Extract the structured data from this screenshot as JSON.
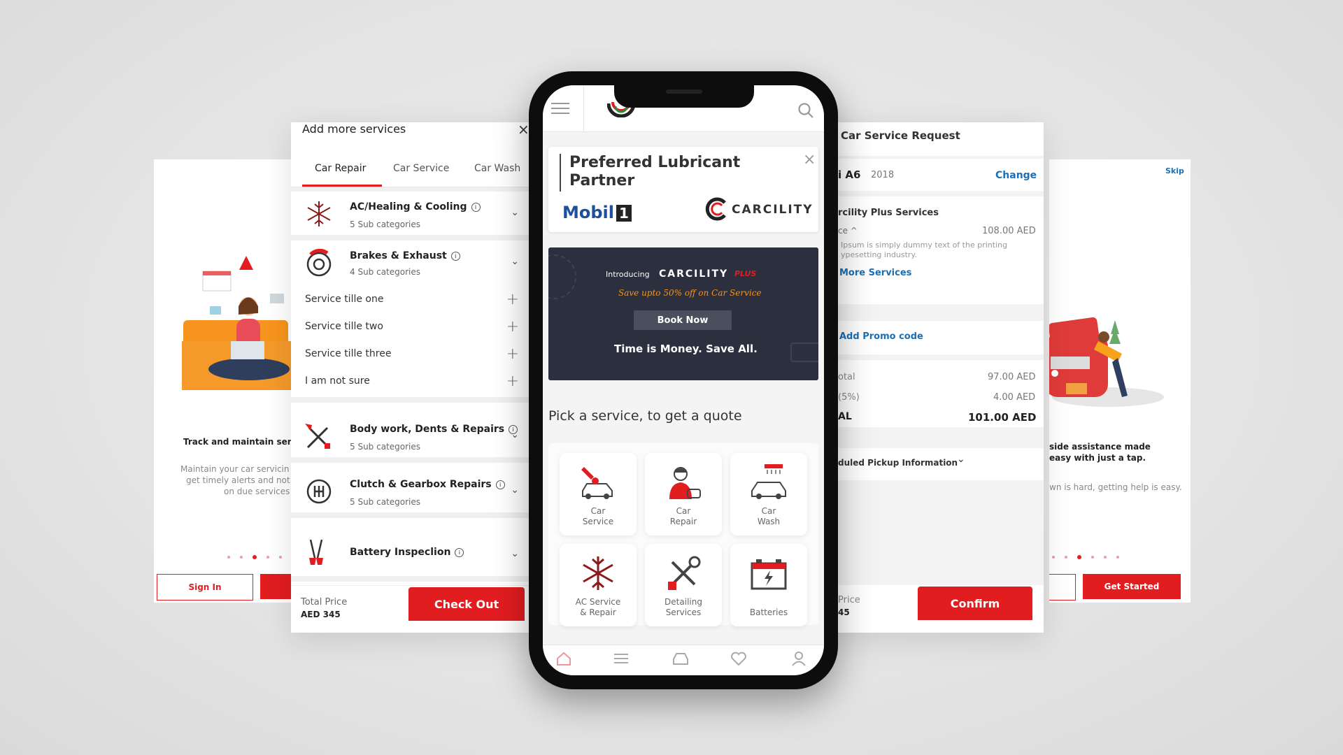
{
  "onboard_left": {
    "title": "Track and maintain servi",
    "body_lines": [
      "Maintain your car servicin",
      "get timely alerts and not",
      "on due services"
    ],
    "sign_in": "Sign In"
  },
  "onboard_right": {
    "skip": "Skip",
    "title_lines": [
      "side assistance made",
      "easy with just a tap."
    ],
    "body": "wn is hard, getting help is easy.",
    "get_started": "Get Started"
  },
  "add_services": {
    "title": "Add more services",
    "close": "×",
    "tabs": [
      "Car Repair",
      "Car Service",
      "Car Wash"
    ],
    "categories": [
      {
        "name": "AC/Healing & Cooling",
        "sub": "5 Sub categories",
        "icon": "snowflake-icon"
      },
      {
        "name": "Brakes & Exhaust",
        "sub": "4 Sub categories",
        "icon": "brake-disc-icon"
      },
      {
        "name": "Body work, Dents & Repairs",
        "sub": "5 Sub categories",
        "icon": "tools-icon"
      },
      {
        "name": "Clutch & Gearbox Repairs",
        "sub": "5 Sub categories",
        "icon": "gearbox-icon"
      },
      {
        "name": "Battery Inspeclion",
        "sub": "",
        "icon": "jumper-cable-icon"
      }
    ],
    "services": [
      "Service tille one",
      "Service tille two",
      "Service tille three",
      "I am not sure"
    ],
    "total_label": "Total Price",
    "total_value": "AED 345",
    "checkout": "Check Out"
  },
  "phone": {
    "partner_title": "Preferred Lubricant",
    "partner_title2": "Partner",
    "close": "×",
    "mobil": "Mobil",
    "mobil_one": "1",
    "carcility": "CARCILITY",
    "promo": {
      "introducing": "Introducing",
      "brand": "CARCILITY",
      "plus": "PLUS",
      "tagline": "Save upto 50% off on Car Service",
      "book": "Book Now",
      "slogan": "Time is Money. Save All."
    },
    "pick_title": "Pick a service, to get a quote",
    "tiles": [
      {
        "label": "Car\nService",
        "icon": "car-service-icon"
      },
      {
        "label": "Car\nRepair",
        "icon": "mechanic-icon"
      },
      {
        "label": "Car\nWash",
        "icon": "car-wash-icon"
      },
      {
        "label": "AC Service\n& Repair",
        "icon": "snowflake-icon"
      },
      {
        "label": "Detailing\nServices",
        "icon": "wrench-icon"
      },
      {
        "label": "Batteries",
        "icon": "battery-icon"
      }
    ],
    "bottom_nav": [
      "home-icon",
      "list-icon",
      "car-icon",
      "heart-icon",
      "profile-icon"
    ]
  },
  "request": {
    "title": "Car Service Request",
    "car": "i A6",
    "year": "2018",
    "change": "Change",
    "plus_services": "rcility Plus Services",
    "price_label": "ce ^",
    "price_value": "108.00 AED",
    "desc_lines": [
      "Ipsum is simply dummy text of the printing",
      "ypesetting industry."
    ],
    "more_services": "More Services",
    "promo_code": "Add Promo code",
    "rows": [
      {
        "label": "otal",
        "value": "97.00 AED"
      },
      {
        "label": "(5%)",
        "value": "4.00 AED"
      },
      {
        "label": "AL",
        "value": "101.00  AED"
      }
    ],
    "pickup": "duled Pickup Information",
    "price_foot": "Price",
    "price_foot_val": "45",
    "confirm": "Confirm"
  },
  "colors": {
    "accent": "#e11d20",
    "link": "#1c6fb4",
    "promo_bg": "#2b2f3e"
  }
}
